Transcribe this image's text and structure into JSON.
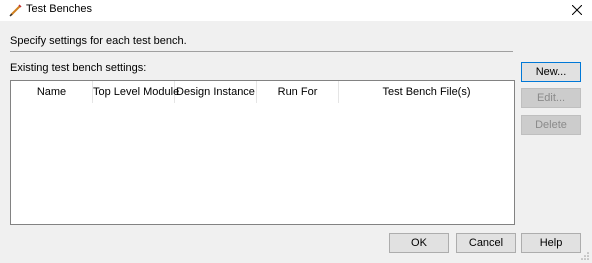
{
  "window": {
    "title": "Test Benches",
    "icon": "edit-pencil-icon",
    "close_icon": "close-icon"
  },
  "description": "Specify settings for each test bench.",
  "existing_label": "Existing test bench settings:",
  "table": {
    "columns": [
      "Name",
      "Top Level Module",
      "Design Instance",
      "Run For",
      "Test Bench File(s)"
    ],
    "rows": []
  },
  "side_buttons": {
    "new": "New...",
    "edit": "Edit...",
    "delete": "Delete"
  },
  "bottom_buttons": {
    "ok": "OK",
    "cancel": "Cancel",
    "help": "Help"
  }
}
